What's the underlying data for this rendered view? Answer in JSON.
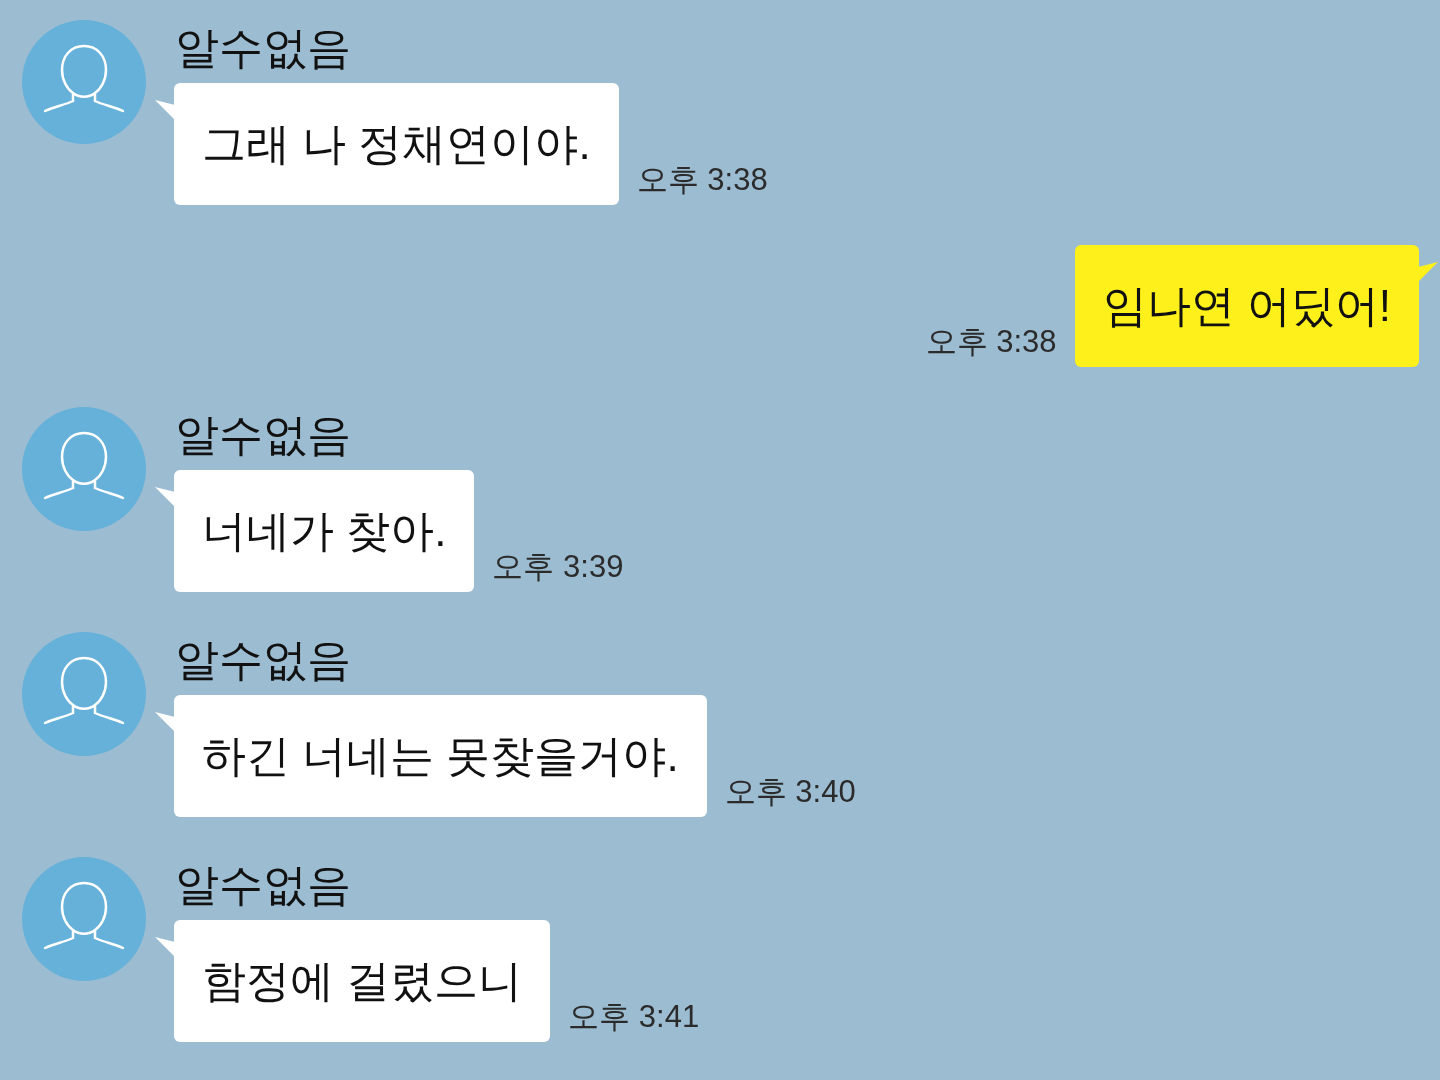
{
  "messages": [
    {
      "kind": "received",
      "sender": "알수없음",
      "text": "그래 나 정채연이야.",
      "time": "오후 3:38"
    },
    {
      "kind": "sent",
      "text": "임나연 어딨어!",
      "time": "오후 3:38"
    },
    {
      "kind": "received",
      "sender": "알수없음",
      "text": "너네가 찾아.",
      "time": "오후 3:39"
    },
    {
      "kind": "received",
      "sender": "알수없음",
      "text": "하긴 너네는 못찾을거야.",
      "time": "오후 3:40"
    },
    {
      "kind": "received",
      "sender": "알수없음",
      "text": "함정에 걸렸으니",
      "time": "오후 3:41"
    }
  ]
}
